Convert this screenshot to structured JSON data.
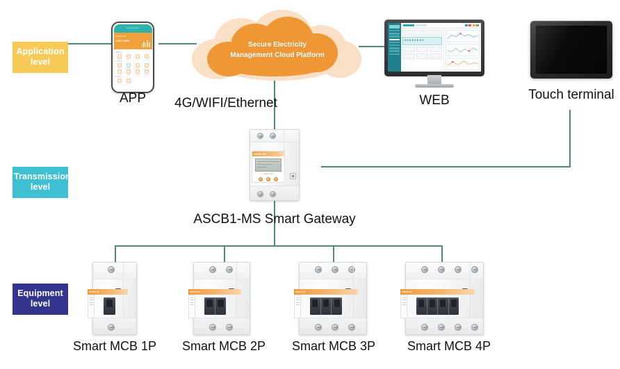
{
  "diagram": {
    "title_levels": [
      {
        "id": "application",
        "label": "Application\nlevel",
        "label_line1": "Application",
        "label_line2": "level",
        "color": "#f7ca58"
      },
      {
        "id": "transmission",
        "label": "Transmission\nlevel",
        "label_line1": "Transmission",
        "label_line2": "level",
        "color": "#3fc0d2"
      },
      {
        "id": "equipment",
        "label": "Equipment\nlevel",
        "label_line1": "Equipment",
        "label_line2": "level",
        "color": "#33348e"
      }
    ],
    "line_color": "#4f8a76",
    "cloud": {
      "text_line1": "Secure Electricity",
      "text_line2": "Management Cloud Platform",
      "inner_color": "#ee9734",
      "outer_color": "#fae0c6"
    },
    "application_nodes": [
      {
        "id": "app",
        "caption": "APP"
      },
      {
        "id": "web",
        "caption": "WEB"
      },
      {
        "id": "terminal",
        "caption": "Touch terminal"
      }
    ],
    "link_label": "4G/WIFI/Ethernet",
    "gateway": {
      "caption": "ASCB1-MS Smart Gateway",
      "brand_text": "ASCB1-MS",
      "lcd_label": "Smart IoT",
      "accent_color": "#ef9d45"
    },
    "equipment_nodes": [
      {
        "id": "mcb-1p",
        "caption": "Smart MCB 1P",
        "poles": 1,
        "label_text": "ASCB1-63"
      },
      {
        "id": "mcb-2p",
        "caption": "Smart MCB 2P",
        "poles": 2,
        "label_text": "ASCB1-63"
      },
      {
        "id": "mcb-3p",
        "caption": "Smart MCB 3P",
        "poles": 3,
        "label_text": "ASCB1-63"
      },
      {
        "id": "mcb-4p",
        "caption": "Smart MCB 4P",
        "poles": 4,
        "label_text": "ASCB1-63"
      }
    ],
    "phone_ui": {
      "status_text": "Smart Energy",
      "card_title": "Total power",
      "card_value": "128.6 kWh",
      "section1": "Monitor",
      "section2": "Control",
      "section3": "Report"
    },
    "web_ui": {
      "meter_value": "0.0  0.0  0.0  0.0"
    }
  }
}
